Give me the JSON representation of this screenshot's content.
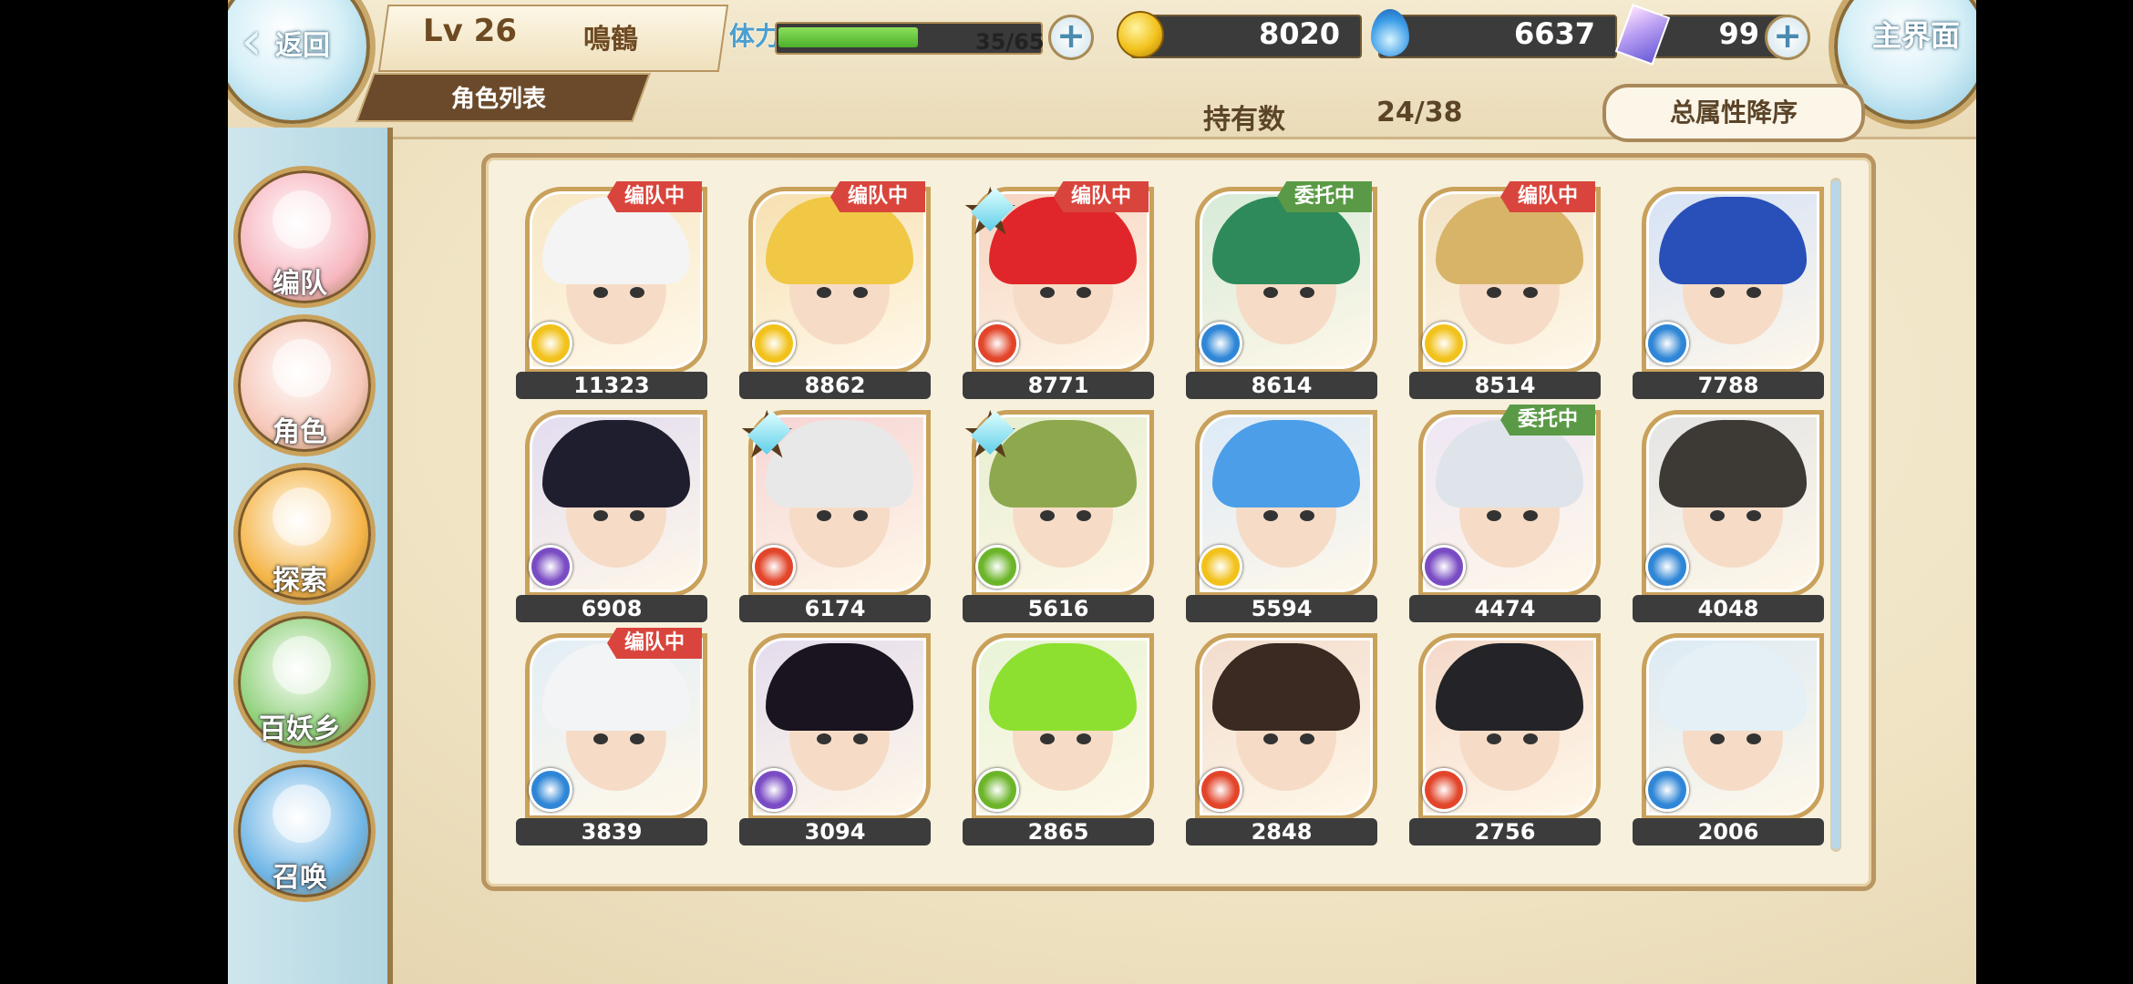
{
  "header": {
    "back_label": "返回",
    "home_label": "主界面",
    "level": "Lv 26",
    "player_name": "鳴鶴",
    "list_tab": "角色列表",
    "stamina_label": "体力",
    "stamina_value": "35/65",
    "stamina_fraction": 0.54,
    "gold": "8020",
    "spirit": "6637",
    "gems": "99"
  },
  "toolbar": {
    "owned_label": "持有数",
    "owned_value": "24/38",
    "sort_label": "总属性降序"
  },
  "sidebar": {
    "items": [
      {
        "label": "编队",
        "icon": "team-icon",
        "color": "#f7b7c0"
      },
      {
        "label": "角色",
        "icon": "character-icon",
        "color": "#f6c7b8"
      },
      {
        "label": "探索",
        "icon": "explore-icon",
        "color": "#f5b548"
      },
      {
        "label": "百妖乡",
        "icon": "village-icon",
        "color": "#8fd17a"
      },
      {
        "label": "召唤",
        "icon": "summon-icon",
        "color": "#6fb6e6"
      }
    ]
  },
  "colors": {
    "badge_team": "#d9453c",
    "badge_delegate": "#5a9a46",
    "attr_light": "#f2c21c",
    "attr_fire": "#e2452a",
    "attr_water": "#2f86d6",
    "attr_dark": "#7a4cc4",
    "attr_wind": "#6cb52a"
  },
  "characters": [
    {
      "score": "11323",
      "badge": "编队中",
      "attr": "light",
      "hair": "#f4f4f4",
      "bg": "#f7e7c4",
      "star": false
    },
    {
      "score": "8862",
      "badge": "编队中",
      "attr": "light",
      "hair": "#f0c846",
      "bg": "#f7e0b0",
      "star": false
    },
    {
      "score": "8771",
      "badge": "编队中",
      "attr": "fire",
      "hair": "#e0262a",
      "bg": "#f6d2c0",
      "star": true
    },
    {
      "score": "8614",
      "badge": "委托中",
      "attr": "water",
      "hair": "#2e8a5a",
      "bg": "#d6ead8",
      "star": false
    },
    {
      "score": "8514",
      "badge": "编队中",
      "attr": "light",
      "hair": "#d8b468",
      "bg": "#f2e2c4",
      "star": false
    },
    {
      "score": "7788",
      "badge": "",
      "attr": "water",
      "hair": "#2850b8",
      "bg": "#d6e2f6",
      "star": false
    },
    {
      "score": "6908",
      "badge": "",
      "attr": "dark",
      "hair": "#1e1e2e",
      "bg": "#e2dcf0",
      "star": false
    },
    {
      "score": "6174",
      "badge": "",
      "attr": "fire",
      "hair": "#e8e8e8",
      "bg": "#f6d4d4",
      "star": true
    },
    {
      "score": "5616",
      "badge": "",
      "attr": "wind",
      "hair": "#8ea84e",
      "bg": "#e6eed0",
      "star": true
    },
    {
      "score": "5594",
      "badge": "",
      "attr": "light",
      "hair": "#4c9ee8",
      "bg": "#dceaf8",
      "star": false
    },
    {
      "score": "4474",
      "badge": "委托中",
      "attr": "dark",
      "hair": "#dfe4ea",
      "bg": "#eee6f4",
      "star": false
    },
    {
      "score": "4048",
      "badge": "",
      "attr": "water",
      "hair": "#3d3a36",
      "bg": "#e4e4e4",
      "star": false
    },
    {
      "score": "3839",
      "badge": "编队中",
      "attr": "water",
      "hair": "#f2f4f6",
      "bg": "#e2eef6",
      "star": false
    },
    {
      "score": "3094",
      "badge": "",
      "attr": "dark",
      "hair": "#1a1420",
      "bg": "#e4dcec",
      "star": false
    },
    {
      "score": "2865",
      "badge": "",
      "attr": "wind",
      "hair": "#8ee030",
      "bg": "#e8f4d6",
      "star": false
    },
    {
      "score": "2848",
      "badge": "",
      "attr": "fire",
      "hair": "#3a2a22",
      "bg": "#f2dccc",
      "star": false
    },
    {
      "score": "2756",
      "badge": "",
      "attr": "fire",
      "hair": "#242428",
      "bg": "#f4d8c8",
      "star": false
    },
    {
      "score": "2006",
      "badge": "",
      "attr": "water",
      "hair": "#e4f0f6",
      "bg": "#dceaf4",
      "star": false
    }
  ]
}
